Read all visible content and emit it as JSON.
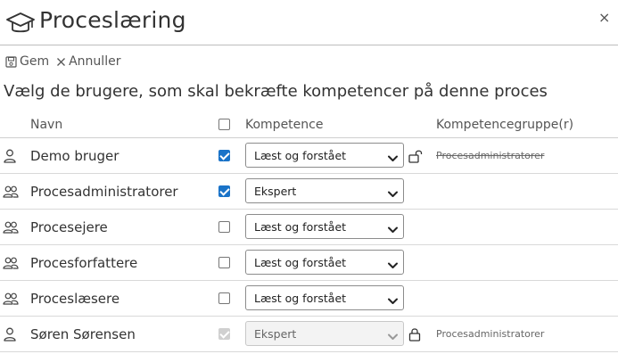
{
  "dialog": {
    "title": "Proceslæring",
    "close_glyph": "×"
  },
  "toolbar": {
    "save_label": "Gem",
    "cancel_label": "Annuller"
  },
  "heading": "Vælg de brugere, som skal bekræfte kompetencer på denne proces",
  "table": {
    "columns": {
      "name": "Navn",
      "competence": "Kompetence",
      "group": "Kompetencegruppe(r)"
    },
    "rows": [
      {
        "icon": "user-icon",
        "name": "Demo bruger",
        "checked": true,
        "disabled": false,
        "competence": "Læst og forstået",
        "lock": "unlocked",
        "group": "Procesadministratorer",
        "group_struck": true
      },
      {
        "icon": "users-icon",
        "name": "Procesadministratorer",
        "checked": true,
        "disabled": false,
        "competence": "Ekspert",
        "lock": "",
        "group": "",
        "group_struck": false
      },
      {
        "icon": "users-icon",
        "name": "Procesejere",
        "checked": false,
        "disabled": false,
        "competence": "Læst og forstået",
        "lock": "",
        "group": "",
        "group_struck": false
      },
      {
        "icon": "users-icon",
        "name": "Procesforfattere",
        "checked": false,
        "disabled": false,
        "competence": "Læst og forstået",
        "lock": "",
        "group": "",
        "group_struck": false
      },
      {
        "icon": "users-icon",
        "name": "Proceslæsere",
        "checked": false,
        "disabled": false,
        "competence": "Læst og forstået",
        "lock": "",
        "group": "",
        "group_struck": false
      },
      {
        "icon": "user-icon",
        "name": "Søren Sørensen",
        "checked": true,
        "disabled": true,
        "competence": "Ekspert",
        "lock": "locked",
        "group": "Procesadministratorer",
        "group_struck": false
      }
    ]
  }
}
